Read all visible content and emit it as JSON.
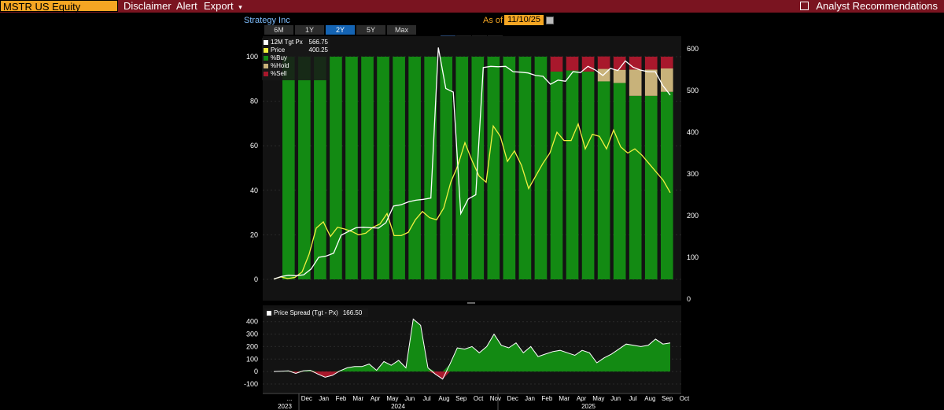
{
  "header": {
    "ticker": "MSTR US Equity",
    "menu": [
      "Disclaimer",
      "Alert",
      "Export"
    ],
    "export_arrow": "▾",
    "title": "Analyst Recommendations",
    "title_icon": "external-link-icon"
  },
  "chart_header": {
    "company": "Strategy Inc",
    "asof_label": "As of",
    "asof_date": "11/10/25",
    "ranges": [
      "6M",
      "1Y",
      "2Y",
      "5Y",
      "Max"
    ],
    "active_range": "2Y",
    "tools": [
      "crosshair-icon",
      "pencil-icon",
      "grid-icon",
      "zoom-icon"
    ]
  },
  "colors": {
    "buy": "#138a13",
    "hold": "#c8b27a",
    "sell": "#a8182c",
    "price": "#f0f040",
    "target": "#ffffff",
    "accent": "#f5a623",
    "bar": "#7a1420"
  },
  "legend": [
    {
      "label": "12M Tgt Px",
      "value": "566.75",
      "color": "#ffffff"
    },
    {
      "label": "Price",
      "value": "400.25",
      "color": "#f0f040"
    },
    {
      "label": "%Buy",
      "value": "",
      "color": "#138a13"
    },
    {
      "label": "%Hold",
      "value": "",
      "color": "#c8b27a"
    },
    {
      "label": "%Sell",
      "value": "",
      "color": "#a8182c"
    }
  ],
  "legend2": {
    "label": "Price Spread (Tgt - Px)",
    "value": "166.50"
  },
  "chart_data": [
    {
      "type": "bar",
      "name": "recommendations",
      "left_axis": {
        "ticks": [
          0,
          20,
          40,
          60,
          80,
          100
        ],
        "ylim": [
          0,
          100
        ]
      },
      "right_axis": {
        "ticks": [
          0,
          100,
          200,
          300,
          400,
          500,
          600
        ],
        "ylim": [
          0,
          600
        ]
      },
      "periods": 25,
      "series": [
        {
          "name": "%Buy",
          "values": [
            100,
            100,
            100,
            100,
            100,
            100,
            100,
            100,
            100,
            100,
            100,
            100,
            100,
            100,
            100,
            100,
            100,
            93.3,
            93.8,
            93.3,
            88.9,
            88.2,
            82.4,
            82.4,
            84.2
          ]
        },
        {
          "name": "%Hold",
          "values": [
            0,
            0,
            0,
            0,
            0,
            0,
            0,
            0,
            0,
            0,
            0,
            0,
            0,
            0,
            0,
            0,
            0,
            0,
            0,
            0,
            5.6,
            5.9,
            11.8,
            11.8,
            10.5
          ]
        },
        {
          "name": "%Sell",
          "values": [
            0,
            0,
            0,
            0,
            0,
            0,
            0,
            0,
            0,
            0,
            0,
            0,
            0,
            0,
            0,
            0,
            0,
            6.7,
            6.2,
            6.7,
            5.6,
            5.9,
            5.8,
            5.8,
            5.3
          ]
        }
      ],
      "lines": [
        {
          "name": "12M Tgt Px",
          "values": [
            48,
            54,
            57,
            56,
            58,
            72,
            100,
            103,
            110,
            153,
            162,
            171,
            172,
            171,
            170,
            183,
            223,
            226,
            233,
            237,
            239,
            242,
            603,
            505,
            496,
            205,
            240,
            250,
            555,
            558,
            557,
            558,
            545,
            544,
            542,
            536,
            534,
            515,
            525,
            522,
            545,
            543,
            558,
            549,
            536,
            553,
            548,
            571,
            556,
            549,
            545,
            545,
            512,
            489
          ]
        },
        {
          "name": "Price",
          "values": [
            48,
            53,
            49,
            52,
            65,
            108,
            170,
            185,
            150,
            172,
            168,
            162,
            154,
            158,
            172,
            180,
            205,
            152,
            152,
            160,
            190,
            210,
            195,
            190,
            218,
            280,
            320,
            375,
            332,
            295,
            280,
            415,
            390,
            330,
            355,
            320,
            265,
            295,
            325,
            350,
            400,
            380,
            380,
            420,
            360,
            395,
            390,
            360,
            405,
            365,
            350,
            360,
            345,
            325,
            305,
            285,
            255
          ]
        }
      ]
    },
    {
      "type": "area",
      "name": "Price Spread (Tgt - Px)",
      "yaxis_ticks": [
        -100,
        0,
        100,
        200,
        300,
        400
      ],
      "ylim": [
        -100,
        480
      ],
      "values": [
        0,
        2,
        5,
        -15,
        5,
        10,
        -20,
        -45,
        -30,
        5,
        30,
        40,
        40,
        60,
        10,
        80,
        50,
        90,
        30,
        420,
        370,
        30,
        -20,
        -60,
        60,
        190,
        180,
        200,
        150,
        200,
        300,
        210,
        190,
        230,
        150,
        200,
        120,
        140,
        160,
        170,
        150,
        130,
        170,
        150,
        70,
        110,
        140,
        180,
        220,
        210,
        200,
        210,
        260,
        220,
        230
      ]
    },
    {
      "type": "axis",
      "name": "x-axis",
      "month_labels": [
        "...",
        "Dec",
        "Jan",
        "Feb",
        "Mar",
        "Apr",
        "May",
        "Jun",
        "Jul",
        "Aug",
        "Sep",
        "Oct",
        "Nov",
        "Dec",
        "Jan",
        "Feb",
        "Mar",
        "Apr",
        "May",
        "Jun",
        "Jul",
        "Aug",
        "Sep",
        "Oct"
      ],
      "year_labels": [
        "2023",
        "2024",
        "2025"
      ]
    }
  ]
}
